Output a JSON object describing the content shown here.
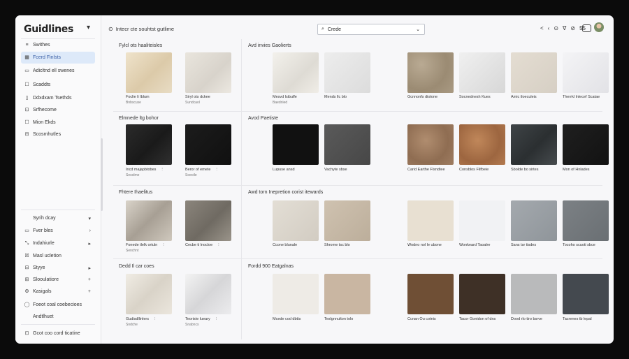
{
  "sidebar": {
    "title": "Guidlines",
    "items": [
      {
        "icon": "≡",
        "label": "Swithes"
      },
      {
        "icon": "▦",
        "label": "Fcerd Finlsts"
      },
      {
        "icon": "▭",
        "label": "Adicltnd ell swenes"
      },
      {
        "icon": "☐",
        "label": "Scaddts"
      },
      {
        "icon": "▯",
        "label": "Ddxdxam Tsethds"
      },
      {
        "icon": "⊡",
        "label": "Srfhecome"
      },
      {
        "icon": "☐",
        "label": "Mion Ekds"
      },
      {
        "icon": "⊟",
        "label": "Scosmhutles"
      }
    ],
    "bottom_items": [
      {
        "icon": "",
        "label": "Syrih dcay",
        "tail": "▾"
      },
      {
        "icon": "▭",
        "label": "Fver bles",
        "tail": "›"
      },
      {
        "icon": "⤡",
        "label": "Indahiurle",
        "tail": "▸"
      },
      {
        "icon": "☒",
        "label": "Masl ucletion",
        "tail": ""
      },
      {
        "icon": "⊟",
        "label": "Styye",
        "tail": "▸"
      },
      {
        "icon": "⊞",
        "label": "Slooulatiore",
        "tail": "+"
      },
      {
        "icon": "⚙",
        "label": "Kasigals",
        "tail": "+"
      },
      {
        "icon": "◯",
        "label": "Foeot coal coebecioes",
        "tail": ""
      },
      {
        "icon": "",
        "label": "Andtlhuet",
        "tail": ""
      },
      {
        "icon": "⊡",
        "label": "Gcot coo cord ticatine",
        "tail": ""
      }
    ]
  },
  "topbar": {
    "brand": "Intecr cte souhtst gutlime",
    "search_value": "Crede",
    "tools": [
      "<",
      "‹",
      "⊙",
      "∇",
      "⊘",
      "5̈5"
    ]
  },
  "sections": [
    {
      "left_title": "Fylcl ots haaliteisles",
      "right_title": "Avd invies Gaolierts",
      "left": [
        {
          "label": "Foclie li Iblum",
          "sub": "Bnbscuse",
          "tail": ""
        },
        {
          "label": "Siryl ots dckee",
          "sub": "Sundcaol",
          "tail": ""
        }
      ],
      "right": [
        {
          "label": "Mesvd lsibulfe",
          "sub": "Baedriied"
        },
        {
          "label": "Mends llc blo",
          "sub": ""
        },
        {
          "label": "Gcnnonfs diotone",
          "sub": ""
        },
        {
          "label": "Socnednesh Kues",
          "sub": ""
        },
        {
          "label": "Amic tloeculeis",
          "sub": ""
        },
        {
          "label": "Therrkl lnlecef Scatae",
          "sub": ""
        }
      ]
    },
    {
      "left_title": "Elmnede ltg bohor",
      "right_title": "Avod Paetiste",
      "left": [
        {
          "label": "Incd majapbtobes",
          "sub": "Sesolme",
          "tail": "⋮"
        },
        {
          "label": "Beror of emete",
          "sub": "Soeoile",
          "tail": "⋮"
        }
      ],
      "right": [
        {
          "label": "Lupuse ansd",
          "sub": ""
        },
        {
          "label": "Vachyte sbse",
          "sub": ""
        },
        {
          "label": "Carid Earthe Flsndtee",
          "sub": ""
        },
        {
          "label": "Consblos Flifbeie",
          "sub": ""
        },
        {
          "label": "Sbolde bo sirtes",
          "sub": ""
        },
        {
          "label": "Mon of Hnlades",
          "sub": ""
        }
      ]
    },
    {
      "left_title": "Fhtere Ihaelitus",
      "right_title": "Awd torn Inepretion corist itewards",
      "left": [
        {
          "label": "Fonede tlelk ortuln",
          "sub": "Senchnt",
          "tail": "⋮"
        },
        {
          "label": "Cecbe ti lnocloe",
          "sub": "",
          "tail": "⋮"
        }
      ],
      "right": [
        {
          "label": "Ccone blunale",
          "sub": ""
        },
        {
          "label": "Shrome tsc blo",
          "sub": ""
        },
        {
          "label": "Wodno nol le ubone",
          "sub": ""
        },
        {
          "label": "Wonkeard Taoalre",
          "sub": ""
        },
        {
          "label": "Sans tsr tisdes",
          "sub": ""
        },
        {
          "label": "Tocoho scuoti sbce",
          "sub": ""
        }
      ]
    },
    {
      "left_title": "Dedd Il car coes",
      "right_title": "Fordd 900 Eatgalnas",
      "left": [
        {
          "label": "Gudisdllinlers",
          "sub": "Sndche",
          "tail": "⋮"
        },
        {
          "label": "Teoriste lueary",
          "sub": "Snabncs",
          "tail": "⋮"
        }
      ],
      "right": [
        {
          "label": "Mcede cod dbtts",
          "sub": ""
        },
        {
          "label": "Teslgnnulton tolo",
          "sub": ""
        },
        {
          "label": "Ccnan Ou cotnis",
          "sub": ""
        },
        {
          "label": "Tacor Gonidon of dns",
          "sub": ""
        },
        {
          "label": "Dood rlo tiro bsrve",
          "sub": ""
        },
        {
          "label": "Tacrenes tb lepal",
          "sub": ""
        }
      ]
    }
  ]
}
